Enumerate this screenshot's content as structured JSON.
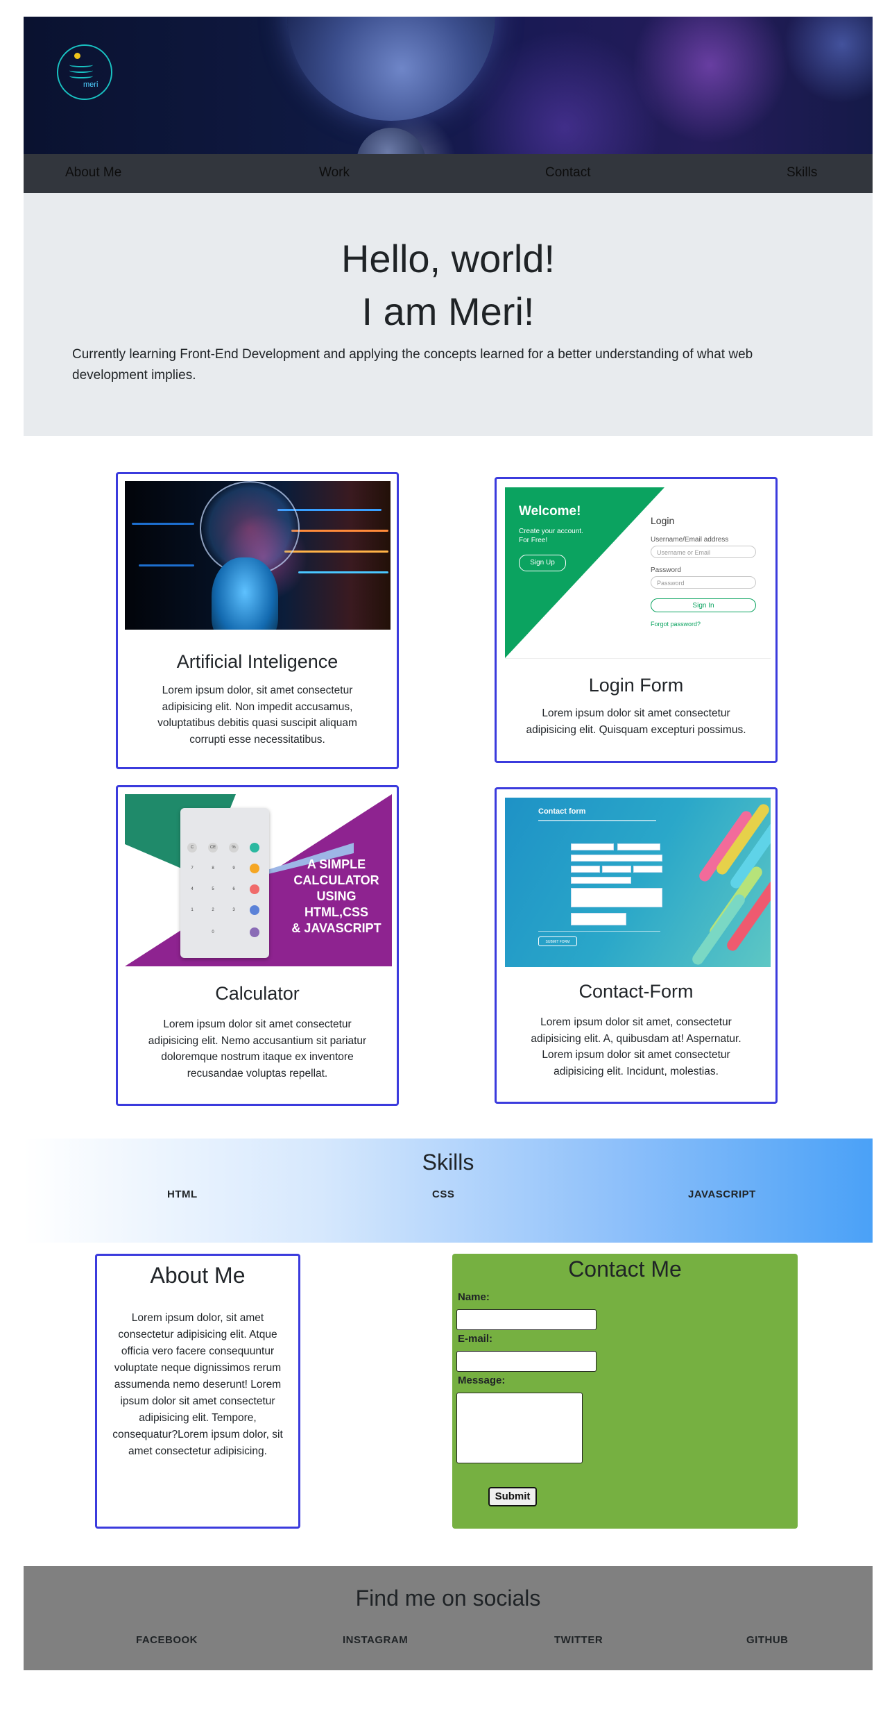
{
  "header": {
    "logo_text": "meri"
  },
  "nav": {
    "items": [
      "About Me",
      "Work",
      "Contact",
      "Skills"
    ]
  },
  "hero": {
    "title_line1": "Hello, world!",
    "title_line2": "I am Meri!",
    "lead": "Currently learning Front-End Development and applying the concepts learned for a better understanding of what web development implies."
  },
  "projects": [
    {
      "title": "Artificial Inteligence",
      "text": "Lorem ipsum dolor, sit amet consectetur adipisicing elit. Non impedit accusamus, voluptatibus debitis quasi suscipit aliquam corrupti esse necessitatibus."
    },
    {
      "title": "Login Form",
      "text": "Lorem ipsum dolor sit amet consectetur adipisicing elit. Quisquam excepturi possimus.",
      "image": {
        "welcome": "Welcome!",
        "subtitle_line1": "Create your account.",
        "subtitle_line2": "For Free!",
        "signup": "Sign Up",
        "login_heading": "Login",
        "username_label": "Username/Email address",
        "username_placeholder": "Username or Email",
        "password_label": "Password",
        "password_placeholder": "Password",
        "signin": "Sign In",
        "forgot": "Forgot password?"
      }
    },
    {
      "title": "Calculator",
      "text": "Lorem ipsum dolor sit amet consectetur adipisicing elit. Nemo accusantium sit pariatur doloremque nostrum itaque ex inventore recusandae voluptas repellat.",
      "image": {
        "caption_line1": "A SIMPLE",
        "caption_line2": "CALCULATOR",
        "caption_line3": "USING HTML,CSS",
        "caption_line4": "& JAVASCRIPT"
      }
    },
    {
      "title": "Contact-Form",
      "text": "Lorem ipsum dolor sit amet, consectetur adipisicing elit. A, quibusdam at! Aspernatur. Lorem ipsum dolor sit amet consectetur adipisicing elit. Incidunt, molestias.",
      "image": {
        "heading": "Contact form",
        "submit": "SUBMIT FORM"
      }
    }
  ],
  "skills": {
    "title": "Skills",
    "items": [
      "HTML",
      "CSS",
      "JAVASCRIPT"
    ],
    "gradient_end": "#4aa1f7"
  },
  "about": {
    "title": "About Me",
    "text": "Lorem ipsum dolor, sit amet consectetur adipisicing elit. Atque officia vero facere consequuntur voluptate neque dignissimos rerum assumenda nemo deserunt! Lorem ipsum dolor sit amet consectetur adipisicing elit. Tempore, consequatur?Lorem ipsum dolor, sit amet consectetur adipisicing."
  },
  "contact": {
    "title": "Contact Me",
    "name_label": "Name:",
    "email_label": "E-mail:",
    "message_label": "Message:",
    "submit_label": "Submit",
    "background": "#76b041"
  },
  "footer": {
    "title": "Find me on socials",
    "socials": [
      "FACEBOOK",
      "INSTAGRAM",
      "TWITTER",
      "GITHUB"
    ]
  },
  "colors": {
    "card_border": "#3b3bdd",
    "nav_bg": "#32363d",
    "jumbo_bg": "#e8ebee",
    "footer_bg": "#808080"
  }
}
